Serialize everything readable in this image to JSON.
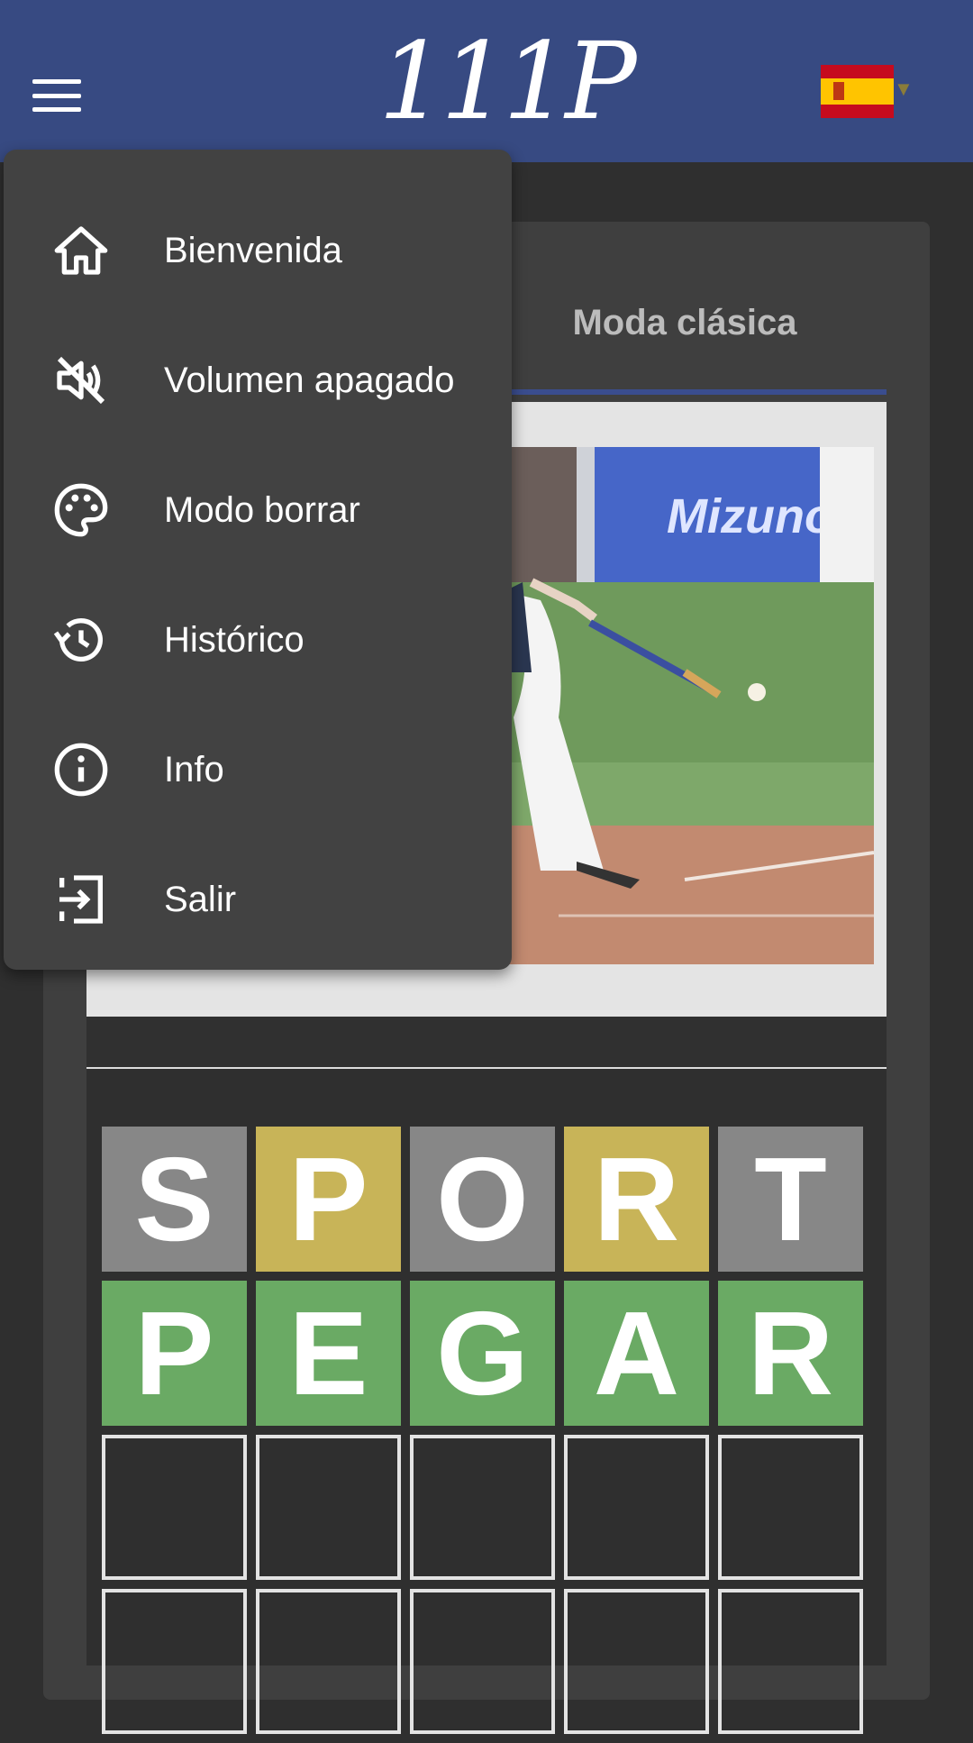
{
  "header": {
    "logo_text": "111P",
    "menu_icon": "hamburger-menu-icon",
    "language_flag": "spain-flag-icon"
  },
  "drawer": {
    "items": [
      {
        "label": "Bienvenida",
        "icon": "home-icon"
      },
      {
        "label": "Volumen apagado",
        "icon": "volume-off-icon"
      },
      {
        "label": "Modo borrar",
        "icon": "palette-icon"
      },
      {
        "label": "Histórico",
        "icon": "history-icon"
      },
      {
        "label": "Info",
        "icon": "info-icon"
      },
      {
        "label": "Salir",
        "icon": "logout-icon"
      }
    ]
  },
  "main": {
    "tab_label": "Moda clásica"
  },
  "board": {
    "rows": [
      {
        "letters": [
          "S",
          "P",
          "O",
          "R",
          "T"
        ],
        "states": [
          "gray",
          "yellow",
          "gray",
          "yellow",
          "gray"
        ]
      },
      {
        "letters": [
          "P",
          "E",
          "G",
          "A",
          "R"
        ],
        "states": [
          "green",
          "green",
          "green",
          "green",
          "green"
        ]
      },
      {
        "letters": [
          "",
          "",
          "",
          "",
          ""
        ],
        "states": [
          "empty",
          "empty",
          "empty",
          "empty",
          "empty"
        ]
      },
      {
        "letters": [
          "",
          "",
          "",
          "",
          ""
        ],
        "states": [
          "empty",
          "empty",
          "empty",
          "empty",
          "empty"
        ]
      }
    ]
  },
  "colors": {
    "header_bg": "#374a82",
    "tile_gray": "#878787",
    "tile_yellow": "#c8b458",
    "tile_green": "#6aaa64",
    "drawer_bg": "#424242"
  }
}
